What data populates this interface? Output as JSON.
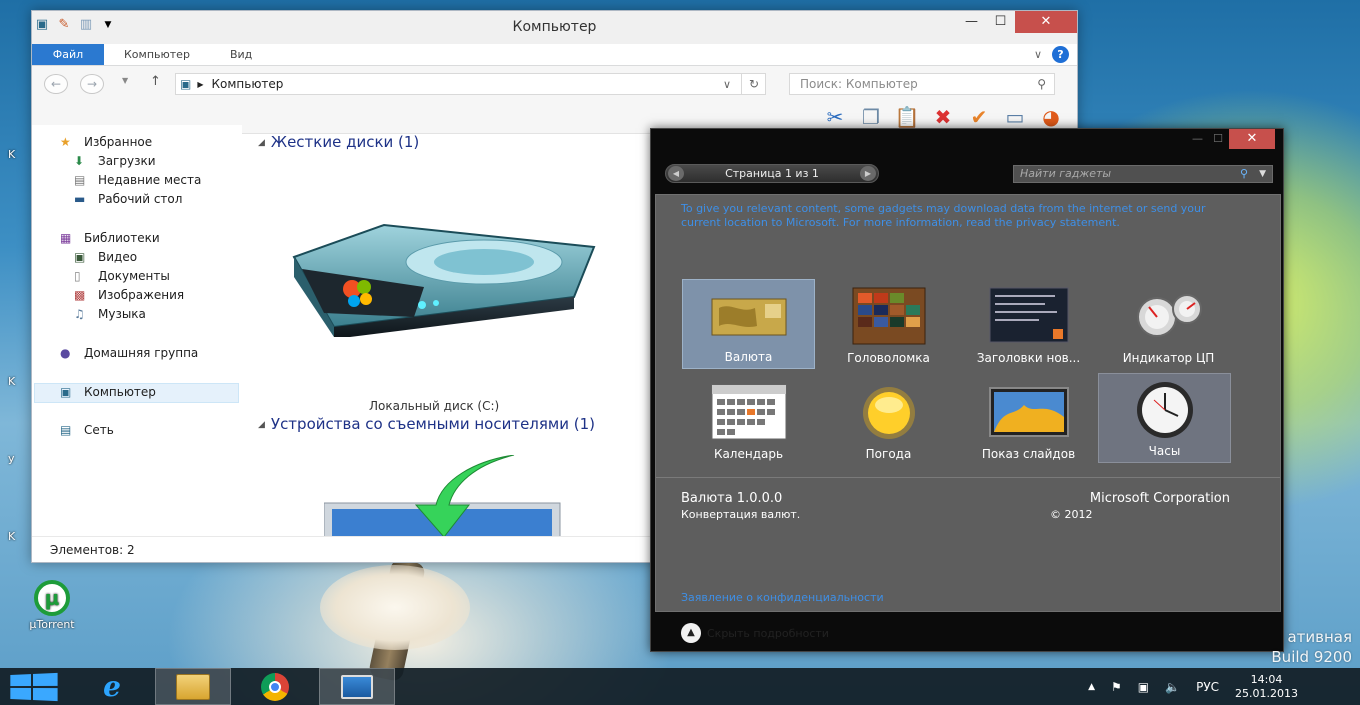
{
  "desktop": {
    "fragments": [
      "K",
      "K",
      "y",
      "K"
    ],
    "utorrent_label": "µTorrent",
    "watermark_line1": "ативная",
    "watermark_line2": "Build 9200"
  },
  "explorer": {
    "title": "Компьютер",
    "tabs": {
      "file": "Файл",
      "computer": "Компьютер",
      "view": "Вид"
    },
    "address": "Компьютер",
    "search_placeholder": "Поиск: Компьютер",
    "nav": {
      "favorites": "Избранное",
      "downloads": "Загрузки",
      "recent": "Недавние места",
      "desktop": "Рабочий стол",
      "libraries": "Библиотеки",
      "video": "Видео",
      "documents": "Документы",
      "images": "Изображения",
      "music": "Музыка",
      "homegroup": "Домашняя группа",
      "computer": "Компьютер",
      "network": "Сеть"
    },
    "group_hdd": "Жесткие диски (1)",
    "drive_c": "Локальный диск (C:)",
    "group_removable": "Устройства со съемными носителями (1)",
    "status": "Элементов: 2"
  },
  "gallery": {
    "pager": "Страница 1 из 1",
    "search_placeholder": "Найти гаджеты",
    "note": "To give you relevant content, some gadgets may download data from the internet or send your current location to Microsoft. For more information, read the privacy statement.",
    "gadgets": [
      {
        "label": "Валюта"
      },
      {
        "label": "Головоломка"
      },
      {
        "label": "Заголовки нов..."
      },
      {
        "label": "Индикатор ЦП"
      },
      {
        "label": "Календарь"
      },
      {
        "label": "Погода"
      },
      {
        "label": "Показ слайдов"
      },
      {
        "label": "Часы"
      }
    ],
    "selected_name": "Валюта 1.0.0.0",
    "selected_desc": "Конвертация валют.",
    "publisher": "Microsoft Corporation",
    "year": "© 2012",
    "privacy_link": "Заявление о конфиденциальности",
    "hide_details": "Скрыть подробности"
  },
  "taskbar": {
    "lang": "РУС",
    "time": "14:04",
    "date": "25.01.2013"
  },
  "colors": {
    "accent": "#2b79d0",
    "close": "#c7504c",
    "link": "#3e8fe6"
  }
}
